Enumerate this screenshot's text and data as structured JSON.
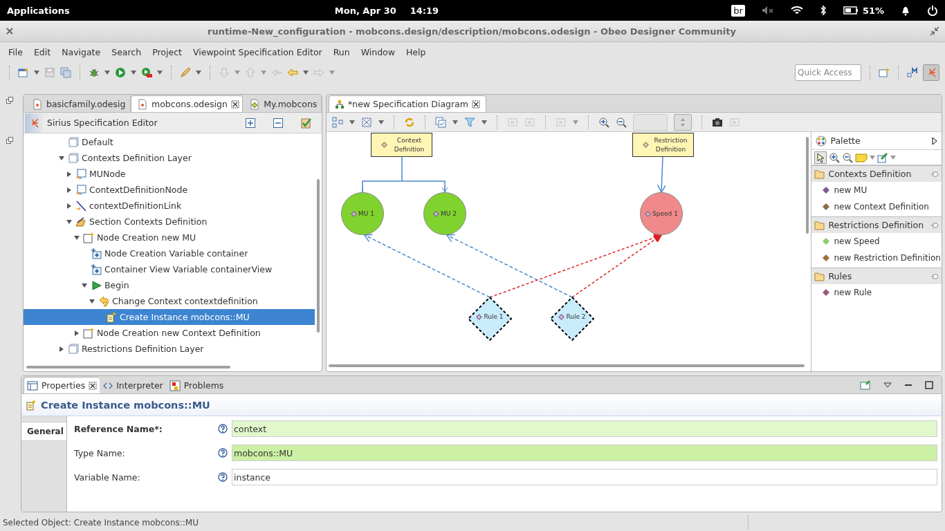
{
  "system_bar": {
    "menu": "Applications",
    "date": "Mon, Apr 30",
    "time": "14:19",
    "badge": "br",
    "battery": "51%"
  },
  "window": {
    "title": "runtime-New_configuration - mobcons.design/description/mobcons.odesign - Obeo Designer Community"
  },
  "menu": [
    "File",
    "Edit",
    "Navigate",
    "Search",
    "Project",
    "Viewpoint Specification Editor",
    "Run",
    "Window",
    "Help"
  ],
  "quick_access": {
    "placeholder": "Quick Access"
  },
  "editor_tabs": [
    {
      "label": "basicfamily.odesig",
      "selected": false
    },
    {
      "label": "mobcons.odesign",
      "selected": true
    },
    {
      "label": "My.mobcons",
      "selected": false
    }
  ],
  "spec_editor": {
    "title": "Sirius Specification Editor",
    "tree": [
      {
        "label": "Default",
        "kind": "layer",
        "selected": false
      },
      {
        "label": "Contexts Definition Layer",
        "kind": "layer",
        "expanded": true,
        "selected": false,
        "children": [
          {
            "label": "MUNode",
            "kind": "node",
            "expanded": false,
            "selected": false
          },
          {
            "label": "ContextDefinitionNode",
            "kind": "node",
            "expanded": false,
            "selected": false
          },
          {
            "label": "contextDefinitionLink",
            "kind": "edge",
            "expanded": false,
            "selected": false
          },
          {
            "label": "Section Contexts Definition",
            "kind": "section",
            "expanded": true,
            "selected": false,
            "children": [
              {
                "label": "Node Creation new MU",
                "kind": "tool",
                "expanded": true,
                "selected": false,
                "children": [
                  {
                    "label": "Node Creation Variable container",
                    "kind": "variable",
                    "selected": false
                  },
                  {
                    "label": "Container View Variable containerView",
                    "kind": "variable",
                    "selected": false
                  },
                  {
                    "label": "Begin",
                    "kind": "begin",
                    "expanded": true,
                    "selected": false,
                    "children": [
                      {
                        "label": "Change Context contextdefinition",
                        "kind": "change",
                        "expanded": true,
                        "selected": false,
                        "children": [
                          {
                            "label": "Create Instance mobcons::MU",
                            "kind": "create",
                            "selected": true
                          }
                        ]
                      }
                    ]
                  }
                ]
              },
              {
                "label": "Node Creation new Context Definition",
                "kind": "tool",
                "expanded": false,
                "selected": false
              }
            ]
          }
        ]
      },
      {
        "label": "Restrictions Definition Layer",
        "kind": "layer",
        "expanded": false,
        "selected": false
      }
    ]
  },
  "diagram": {
    "tab": {
      "label": "*new Specification Diagram",
      "selected": true
    },
    "nodes": [
      {
        "kind": "note",
        "label": "Context Definition",
        "color": "#fff5b4"
      },
      {
        "kind": "note",
        "label": "Restriction Definition",
        "color": "#fff5b4"
      },
      {
        "kind": "circle",
        "label": "MU 1",
        "color": "#80d32e"
      },
      {
        "kind": "circle",
        "label": "MU 2",
        "color": "#80d32e"
      },
      {
        "kind": "circle",
        "label": "Speed 1",
        "color": "#f08a8a"
      },
      {
        "kind": "diamond",
        "label": "Rule 1",
        "color": "#c8ecfa"
      },
      {
        "kind": "diamond",
        "label": "Rule 2",
        "color": "#c8ecfa"
      }
    ]
  },
  "palette": {
    "title": "Palette",
    "drawers": [
      {
        "label": "Contexts Definition",
        "items": [
          {
            "label": "new MU",
            "color": "#7d5a8c"
          },
          {
            "label": "new Context Definition",
            "color": "#8a6a4a"
          }
        ]
      },
      {
        "label": "Restrictions Definition",
        "items": [
          {
            "label": "new Speed",
            "color": "#8ccc6e"
          },
          {
            "label": "new Restriction Definition",
            "color": "#a0703a"
          }
        ]
      },
      {
        "label": "Rules",
        "items": [
          {
            "label": "new Rule",
            "color": "#9a5a7a"
          }
        ]
      }
    ]
  },
  "properties": {
    "tabs": [
      {
        "label": "Properties",
        "selected": true
      },
      {
        "label": "Interpreter",
        "selected": false
      },
      {
        "label": "Problems",
        "selected": false
      }
    ],
    "title": "Create Instance mobcons::MU",
    "section_tabs": [
      {
        "label": "General",
        "selected": true
      }
    ],
    "fields": [
      {
        "label": "Reference Name*:",
        "required": true,
        "value": "context",
        "color": "#e2f8cc"
      },
      {
        "label": "Type Name:",
        "required": false,
        "value": "mobcons::MU",
        "color": "#ccf0a4"
      },
      {
        "label": "Variable Name:",
        "required": false,
        "value": "instance",
        "color": "#ffffff"
      }
    ]
  },
  "status_bar": "Selected Object: Create Instance mobcons::MU"
}
